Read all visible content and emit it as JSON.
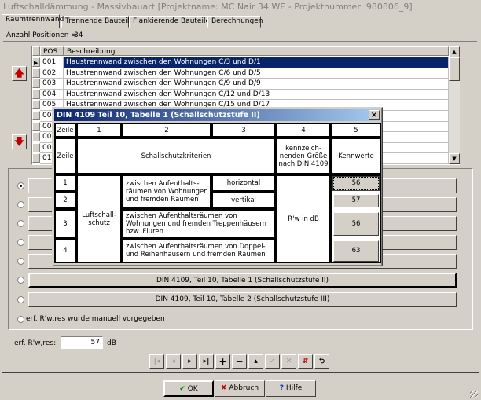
{
  "window": {
    "title": "Luftschalldämmung - Massivbauart [Projektname: MC Nair 34 WE - Projektnummer: 980806_9]"
  },
  "tabs": [
    "Raumtrennwand",
    "Trennende Bauteile",
    "Flankierende Bauteile",
    "Berechnungen"
  ],
  "positions": {
    "label": "Anzahl Positionen =",
    "count": "34"
  },
  "grid": {
    "headers": [
      "POS",
      "Beschreibung"
    ],
    "rows": [
      {
        "pos": "001",
        "desc": "Haustrennwand zwischen den Wohnungen C/3 und D/1"
      },
      {
        "pos": "002",
        "desc": "Haustrennwand zwischen den Wohnungen C/6 und D/5"
      },
      {
        "pos": "003",
        "desc": "Haustrennwand zwischen den Wohnungen C/9 und D/9"
      },
      {
        "pos": "004",
        "desc": "Haustrennwand zwischen den Wohnungen C/12 und D/13"
      },
      {
        "pos": "005",
        "desc": "Haustrennwand zwischen den Wohnungen C/15 und D/17"
      },
      {
        "pos": "00",
        "desc": ""
      },
      {
        "pos": "00",
        "desc": ""
      },
      {
        "pos": "00",
        "desc": ""
      },
      {
        "pos": "00",
        "desc": ""
      },
      {
        "pos": "01",
        "desc": ""
      }
    ]
  },
  "options": {
    "btn6": "DIN 4109, Teil 10, Tabelle 1 (Schallschutzstufe II)",
    "btn7": "DIN 4109, Teil 10, Tabelle 2 (Schallschutzstufe III)",
    "manual": "erf. R'w,res wurde manuell vorgegeben"
  },
  "erf": {
    "label": "erf. R'w,res:",
    "value": "57",
    "unit": "dB"
  },
  "nav_icons": [
    "first-icon",
    "prior-icon",
    "next-icon",
    "last-icon",
    "insert-icon",
    "delete-icon",
    "edit-icon",
    "post-icon",
    "cancel-icon",
    "refresh-icon",
    "undo-icon"
  ],
  "buttons": {
    "ok": "OK",
    "cancel": "Abbruch",
    "help": "Hilfe"
  },
  "dialog": {
    "title": "DIN 4109 Teil 10, Tabelle 1 (Schallschutzstufe II)",
    "header_nums": [
      "Zeile",
      "1",
      "2",
      "3",
      "4",
      "5"
    ],
    "row2": {
      "zeile": "Zeile",
      "kriterien": "Schallschutzkriterien",
      "groesse": "kennzeich-nenden Größe nach DIN 4109",
      "kennwerte": "Kennwerte"
    },
    "luft": "Luftschall-schutz",
    "rows": [
      {
        "z": "1",
        "text": "zwischen Aufenthalts-räumen von Wohnungen und fremden Räumen",
        "dir": "horizontal",
        "val": "56"
      },
      {
        "z": "2",
        "dir": "vertikal",
        "val": "57"
      },
      {
        "z": "3",
        "text": "zwischen Aufenthaltsräumen von Wohnungen und fremden Treppenhäusern bzw. Fluren",
        "val": "56"
      },
      {
        "z": "4",
        "text": "zwischen Aufenthaltsräumen von Doppel- und Reihenhäusern und fremden Räumen",
        "val": "63"
      }
    ],
    "rw": "R'w in dB",
    "close": "×"
  }
}
